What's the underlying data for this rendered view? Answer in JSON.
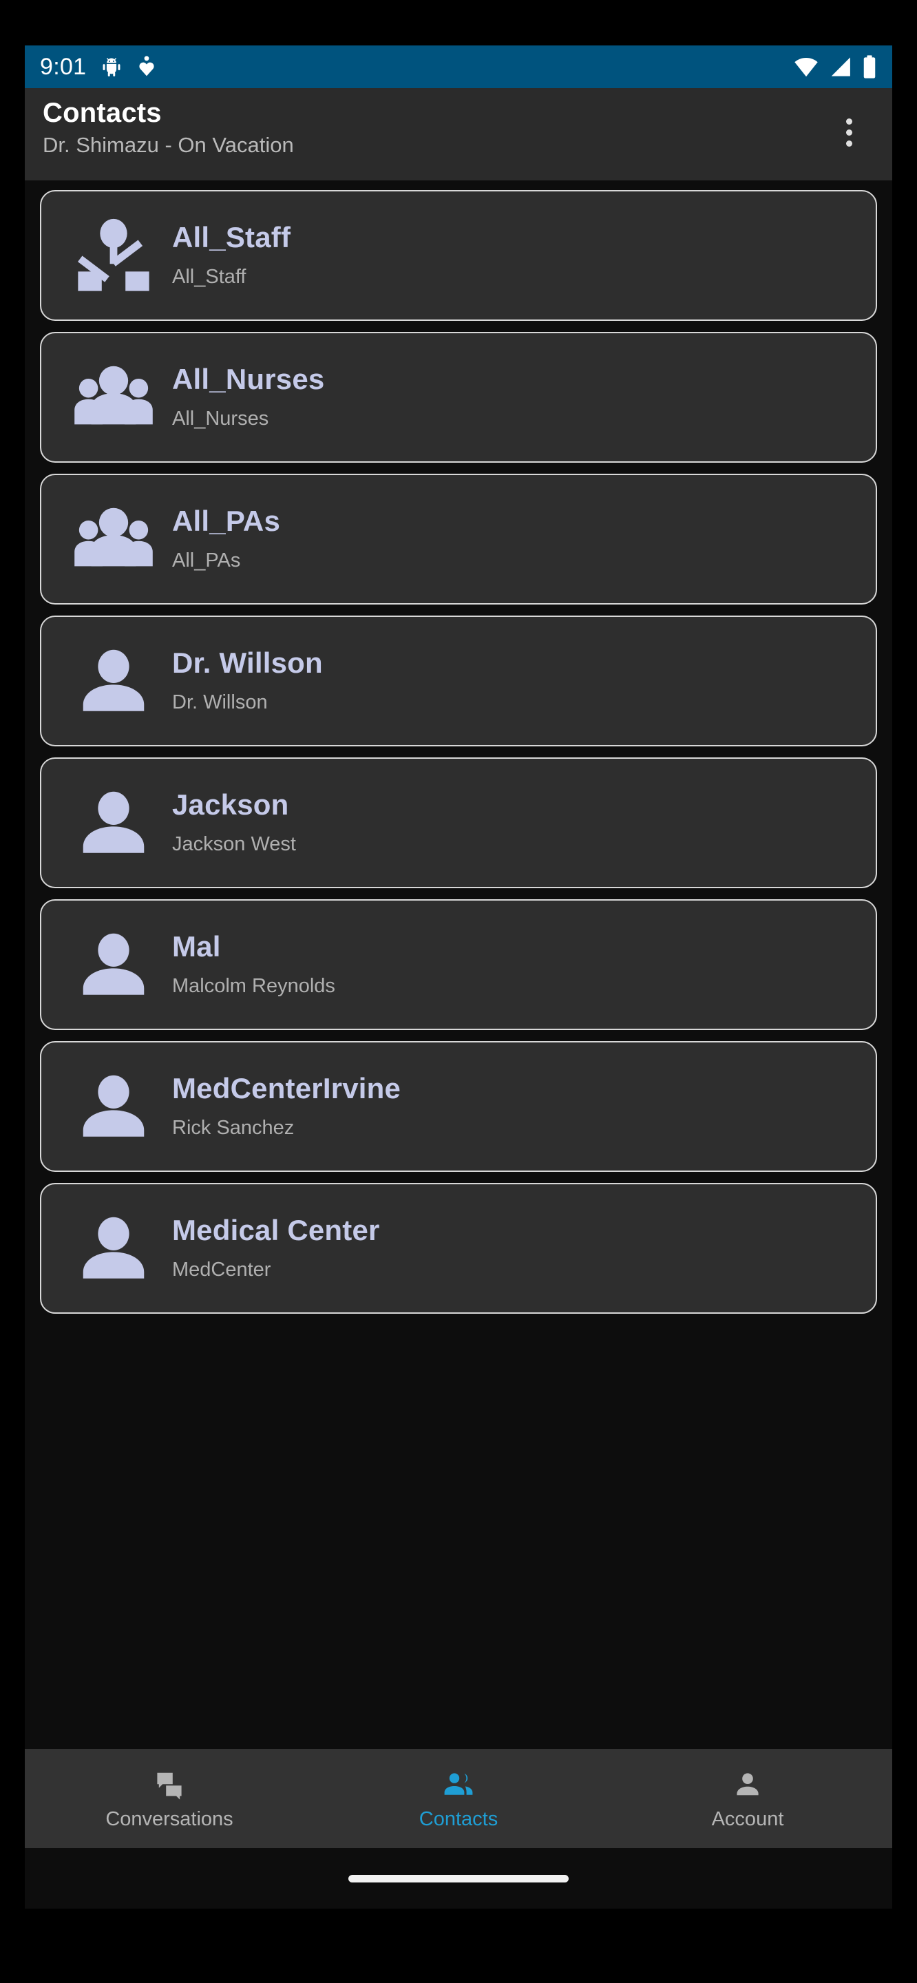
{
  "status_bar": {
    "time": "9:01",
    "left_icons": [
      "android-bug-icon",
      "heart-pin-icon"
    ],
    "right_icons": [
      "wifi-icon",
      "cell-signal-icon",
      "battery-full-icon"
    ],
    "background_color": "#00537e",
    "foreground_color": "#ffffff"
  },
  "app_bar": {
    "title": "Contacts",
    "subtitle": "Dr. Shimazu - On Vacation",
    "overflow_menu": "more-options"
  },
  "contacts": [
    {
      "name": "All_Staff",
      "detail": "All_Staff",
      "icon": "org-chart-icon"
    },
    {
      "name": "All_Nurses",
      "detail": "All_Nurses",
      "icon": "group-icon"
    },
    {
      "name": "All_PAs",
      "detail": "All_PAs",
      "icon": "group-icon"
    },
    {
      "name": "Dr. Willson",
      "detail": "Dr. Willson",
      "icon": "person-icon"
    },
    {
      "name": "Jackson",
      "detail": "Jackson West",
      "icon": "person-icon"
    },
    {
      "name": "Mal",
      "detail": "Malcolm  Reynolds",
      "icon": "person-icon"
    },
    {
      "name": "MedCenterIrvine",
      "detail": "Rick Sanchez",
      "icon": "person-icon"
    },
    {
      "name": "Medical Center",
      "detail": "MedCenter",
      "icon": "person-icon"
    }
  ],
  "bottom_nav": {
    "active": "Contacts",
    "items": [
      {
        "label": "Conversations",
        "icon": "chat-bubbles-icon",
        "active": false
      },
      {
        "label": "Contacts",
        "icon": "people-icon",
        "active": true
      },
      {
        "label": "Account",
        "icon": "person-icon",
        "active": false
      }
    ],
    "active_color": "#1f9ed4",
    "inactive_color": "#b5b5b5"
  },
  "theme": {
    "card_background": "#2e2e2e",
    "card_border": "#d8d8d8",
    "title_color": "#c5cae9",
    "subtitle_color": "#b0b0b0",
    "screen_background": "#0d0d0d"
  }
}
